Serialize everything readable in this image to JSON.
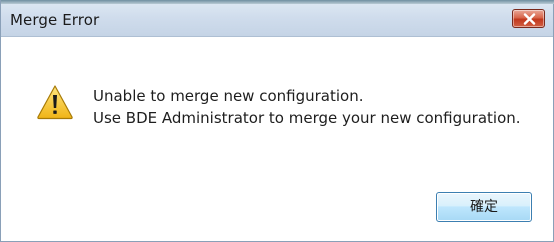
{
  "window": {
    "title": "Merge Error",
    "close_icon": "close-x-icon"
  },
  "message": {
    "icon": "warning-triangle-icon",
    "line1": "Unable to merge new configuration.",
    "line2": "Use BDE Administrator to merge your new configuration."
  },
  "buttons": {
    "ok_label": "確定"
  },
  "colors": {
    "titlebar": "#cfdcec",
    "close_button": "#c1381d",
    "ok_button_border": "#3c7fb1",
    "warning_yellow": "#f5c22b"
  }
}
